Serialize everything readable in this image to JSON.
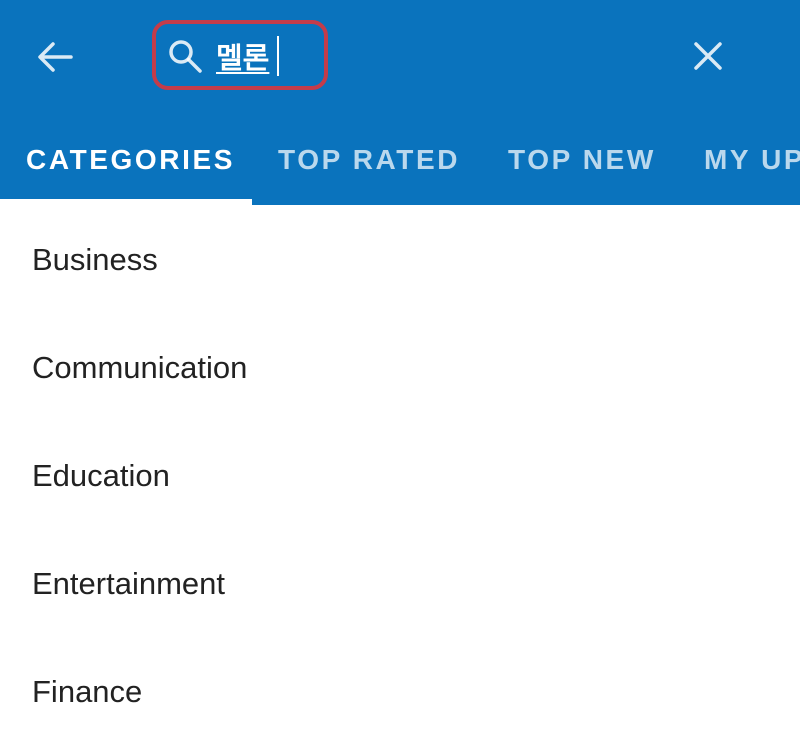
{
  "header": {
    "back_icon": "arrow-left-icon",
    "search": {
      "icon": "search-icon",
      "value": "멜론"
    },
    "clear_icon": "close-icon",
    "background_color": "#0a73bd"
  },
  "tabs": [
    {
      "label": "CATEGORIES",
      "active": true
    },
    {
      "label": "TOP RATED",
      "active": false
    },
    {
      "label": "TOP NEW",
      "active": false
    },
    {
      "label": "MY UP",
      "active": false
    }
  ],
  "categories": [
    {
      "label": "Business"
    },
    {
      "label": "Communication"
    },
    {
      "label": "Education"
    },
    {
      "label": "Entertainment"
    },
    {
      "label": "Finance"
    }
  ]
}
